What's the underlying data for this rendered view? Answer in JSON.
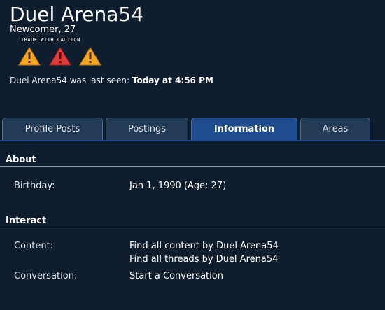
{
  "profile": {
    "name": "Duel Arena54",
    "title": "Newcomer, 27",
    "banner": {
      "text": "TRADE WITH CAUTION",
      "icons": [
        {
          "icon": "warning-icon",
          "color": "#f5a623"
        },
        {
          "icon": "warning-icon",
          "color": "#e23b3b"
        },
        {
          "icon": "warning-icon",
          "color": "#f5a623"
        }
      ]
    },
    "last_seen_prefix": "Duel Arena54 was last seen:",
    "last_seen_value": "Today at 4:56 PM"
  },
  "tabs": [
    {
      "label": "Profile Posts",
      "active": false
    },
    {
      "label": "Postings",
      "active": false
    },
    {
      "label": "Information",
      "active": true
    },
    {
      "label": "Areas",
      "active": false
    }
  ],
  "about": {
    "heading": "About",
    "rows": [
      {
        "label": "Birthday:",
        "value": "Jan 1, 1990 (Age: 27)"
      }
    ]
  },
  "interact": {
    "heading": "Interact",
    "content_label": "Content:",
    "content_links": [
      "Find all content by Duel Arena54",
      "Find all threads by Duel Arena54"
    ],
    "conversation_label": "Conversation:",
    "conversation_link": "Start a Conversation"
  },
  "colors": {
    "background": "#0f1e2e",
    "accent": "#1f4b8f",
    "tab": "#233a54"
  }
}
